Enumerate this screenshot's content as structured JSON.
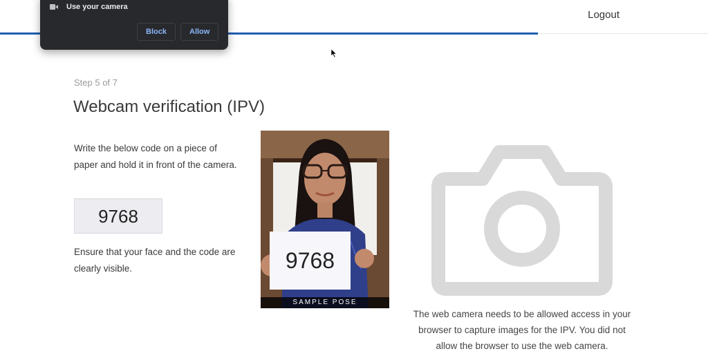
{
  "browser_prompt": {
    "message": "Use your camera",
    "block_label": "Block",
    "allow_label": "Allow"
  },
  "header": {
    "logout_label": "Logout",
    "progress": 0.76
  },
  "main": {
    "step_text": "Step 5 of 7",
    "title": "Webcam verification (IPV)",
    "instruction": "Write the below code on a piece of paper and hold it in front of the camera.",
    "code": "9768",
    "instruction2": "Ensure that your face and the code are clearly visible.",
    "sample": {
      "caption": "SAMPLE POSE",
      "code": "9768"
    },
    "camera_message": "The web camera needs to be allowed access in your browser to capture images for the IPV. You did not allow the browser to use the web camera."
  },
  "icons": {
    "camera_placeholder": "camera-icon",
    "prompt_camera": "video-camera-icon"
  },
  "colors": {
    "accent": "#1f5fb0",
    "prompt_bg": "#28292c",
    "prompt_button_text": "#8ab4f8",
    "placeholder_icon": "#d9d9d9"
  }
}
